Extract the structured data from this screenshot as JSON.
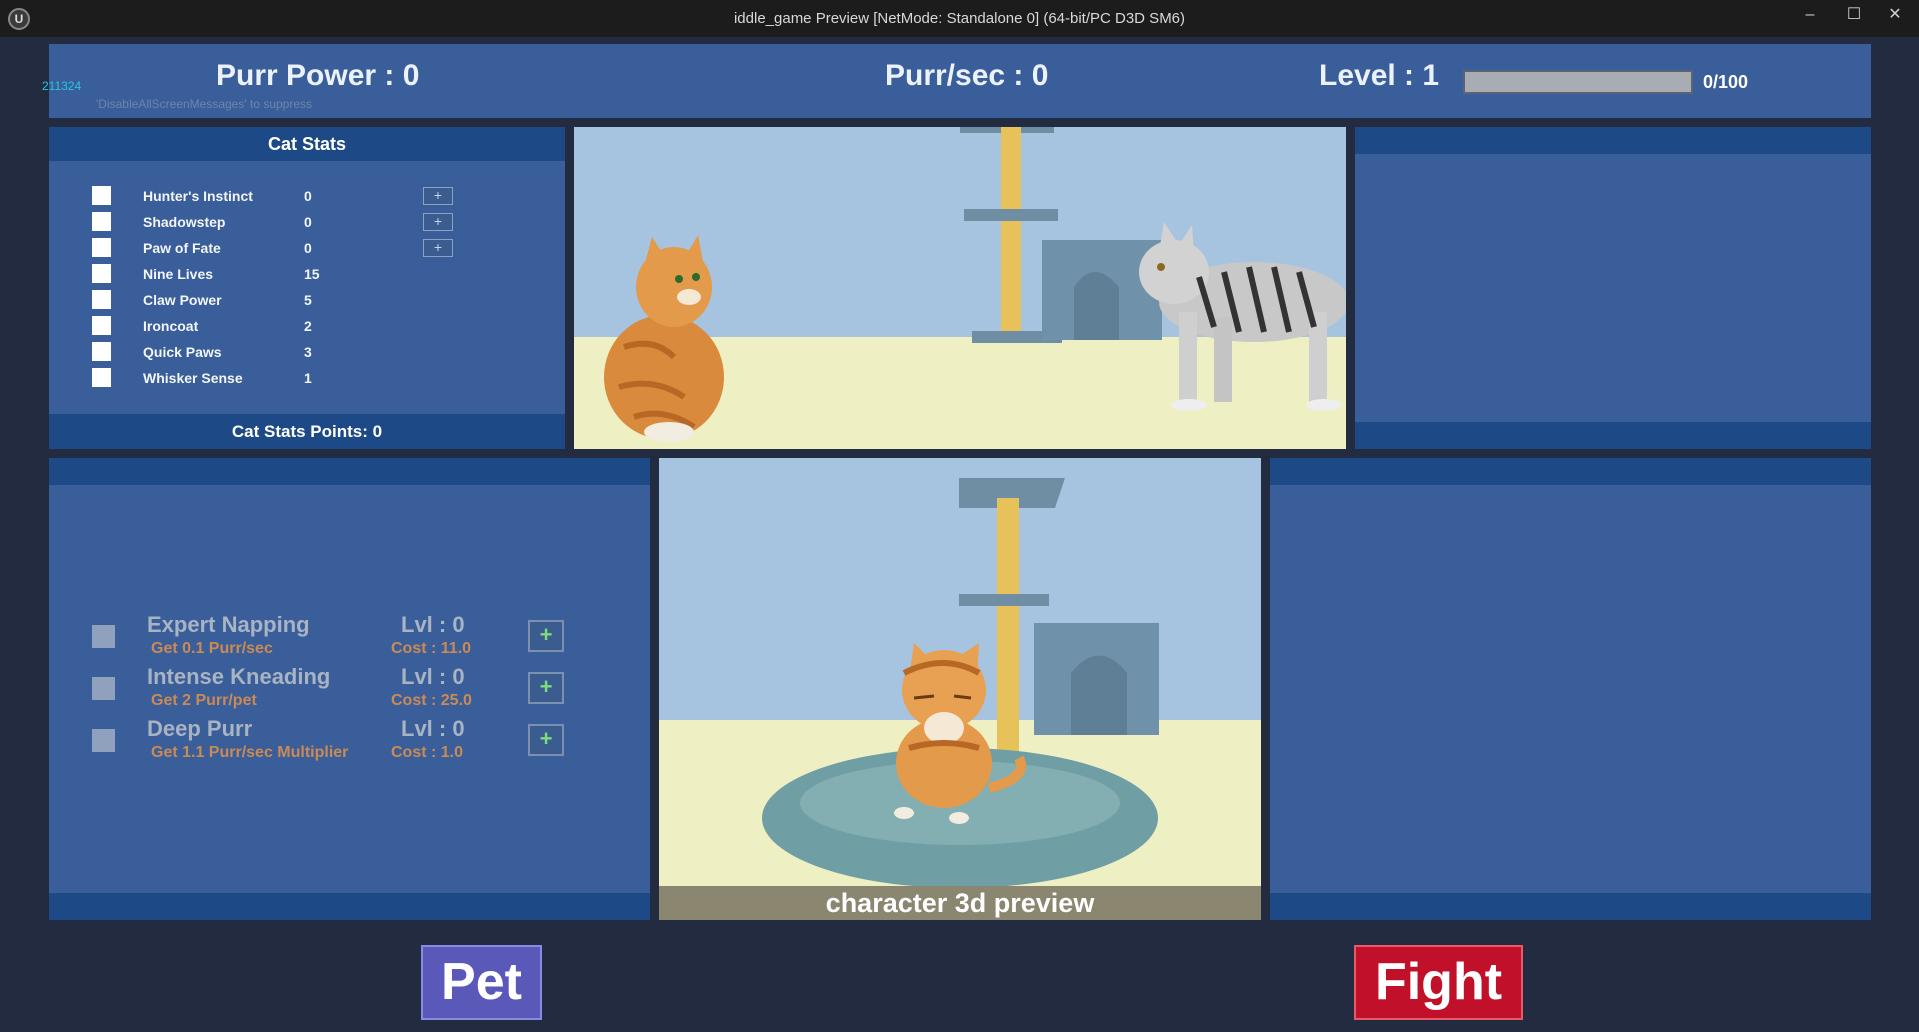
{
  "window": {
    "title": "iddle_game Preview [NetMode: Standalone 0]  (64-bit/PC D3D SM6)",
    "minimize": "–",
    "maximize": "☐",
    "close": "✕",
    "logo": "U"
  },
  "debug": {
    "id": "211324",
    "message": "'DisableAllScreenMessages' to suppress"
  },
  "hud": {
    "purr_power": "Purr Power : 0",
    "purr_sec": "Purr/sec : 0",
    "level": "Level : 1",
    "xp_label": "0/100",
    "xp_fraction": 0
  },
  "cat_stats": {
    "title": "Cat Stats",
    "points": "Cat Stats Points: 0",
    "plus": "+",
    "items": [
      {
        "name": "Hunter's Instinct",
        "value": "0"
      },
      {
        "name": "Shadowstep",
        "value": "0"
      },
      {
        "name": "Paw of Fate",
        "value": "0"
      },
      {
        "name": "Nine Lives",
        "value": "15"
      },
      {
        "name": "Claw Power",
        "value": "5"
      },
      {
        "name": "Ironcoat",
        "value": "2"
      },
      {
        "name": "Quick Paws",
        "value": "3"
      },
      {
        "name": "Whisker Sense",
        "value": "1"
      }
    ]
  },
  "upgrades": {
    "plus": "+",
    "items": [
      {
        "name": "Expert Napping",
        "desc": "Get 0.1 Purr/sec",
        "level": "Lvl : 0",
        "cost": "Cost : 11.0"
      },
      {
        "name": "Intense Kneading",
        "desc": "Get 2 Purr/pet",
        "level": "Lvl : 0",
        "cost": "Cost : 25.0"
      },
      {
        "name": "Deep Purr",
        "desc": "Get 1.1 Purr/sec Multiplier",
        "level": "Lvl : 0",
        "cost": "Cost : 1.0"
      }
    ]
  },
  "preview": {
    "label": "character 3d preview"
  },
  "buttons": {
    "pet": "Pet",
    "fight": "Fight"
  },
  "colors": {
    "background": "#222b3f",
    "panel": "#3a5e99",
    "panel_bar": "#1d4a86",
    "pet_button": "#5a58b8",
    "fight_button": "#c0102a",
    "upgrade_desc": "#c98a56"
  }
}
